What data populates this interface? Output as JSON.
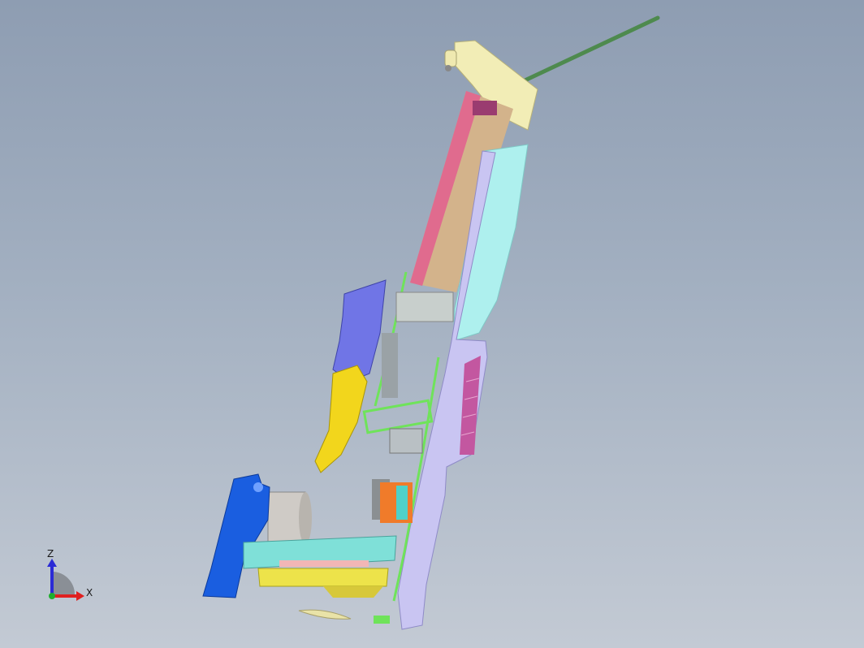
{
  "viewport": {
    "background_top": "#8e9db2",
    "background_bottom": "#c3cad4",
    "model": "exploded-assembly"
  },
  "axis_triad": {
    "z_label": "Z",
    "x_label": "X",
    "z_color": "#2b2bd6",
    "x_color": "#e02020",
    "y_color": "#1fae2e"
  },
  "parts": {
    "rod_color": "#4e8a4e",
    "top_bracket_color": "#f2edb6",
    "cylinder_color": "#d3b38b",
    "cylinder_highlight": "#e06b8e",
    "cover_color": "#aef0ee",
    "housing_color": "#c9c5f2",
    "keypad_color": "#c357a0",
    "frame_color": "#6fe35a",
    "handle_color": "#7075e6",
    "trigger_color": "#f2d61c",
    "blue_part_color": "#1a5ee0",
    "base_plate_color": "#7fe0d8",
    "battery_color": "#ede34a",
    "motor_color": "#cfcbc6",
    "orange_part_color": "#f07b2a"
  }
}
